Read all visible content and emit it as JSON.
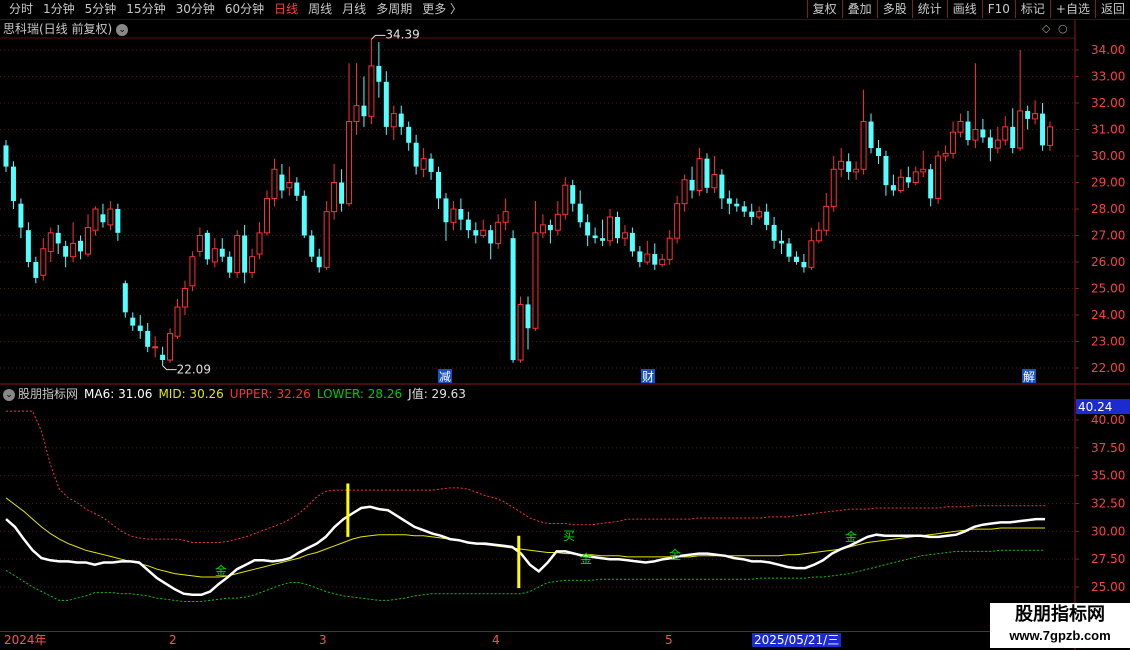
{
  "toolbar": {
    "periods": [
      "分时",
      "1分钟",
      "5分钟",
      "15分钟",
      "30分钟",
      "60分钟",
      "日线",
      "周线",
      "月线",
      "多周期",
      "更多"
    ],
    "active_period": "日线",
    "more_arrow": "〉",
    "buttons": [
      "复权",
      "叠加",
      "多股",
      "统计",
      "画线",
      "F10",
      "标记",
      "+自选",
      "返回"
    ]
  },
  "main": {
    "title": "思科瑞(日线 前复权)",
    "price_axis": [
      "34.00",
      "33.00",
      "32.00",
      "31.00",
      "30.00",
      "29.00",
      "28.00",
      "27.00",
      "26.00",
      "25.00",
      "24.00",
      "23.00",
      "22.00"
    ],
    "high_label": "34.39",
    "low_label": "22.09",
    "markers": [
      "减",
      "财",
      "解"
    ]
  },
  "indicator": {
    "name": "股朋指标网",
    "ma6_label": "MA6: 31.06",
    "mid_label": "MID: 30.26",
    "upper_label": "UPPER: 32.26",
    "lower_label": "LOWER: 28.26",
    "j_label": "J值: 29.63",
    "axis": [
      "40.00",
      "37.50",
      "35.00",
      "32.50",
      "30.00",
      "27.50",
      "25.00"
    ],
    "axis_top_value": "40.24",
    "signals": [
      "金",
      "买",
      "金",
      "金",
      "金"
    ]
  },
  "date_axis": {
    "labels": [
      "2024年",
      "2",
      "3",
      "4",
      "5"
    ],
    "highlight": "2025/05/21/三"
  },
  "watermark": {
    "line1": "股朋指标网",
    "line2": "www.7gpzb.com"
  },
  "colors": {
    "up": "#ff3030",
    "down": "#54ffff",
    "ma6": "#ffffff",
    "mid": "#e6e600",
    "upper": "#ff3030",
    "lower": "#00cc00"
  },
  "chart_data": {
    "type": "candlestick",
    "y_range": [
      22.0,
      34.0
    ],
    "candles": [
      [
        30.4,
        29.6,
        30.6,
        29.4
      ],
      [
        29.6,
        28.3,
        29.8,
        28.0
      ],
      [
        28.2,
        27.3,
        28.4,
        26.9
      ],
      [
        27.2,
        26.0,
        27.5,
        25.8
      ],
      [
        26.0,
        25.4,
        26.2,
        25.2
      ],
      [
        25.5,
        26.5,
        26.9,
        25.3
      ],
      [
        26.4,
        27.1,
        27.3,
        26.0
      ],
      [
        27.1,
        26.7,
        27.4,
        26.3
      ],
      [
        26.6,
        26.2,
        26.8,
        25.8
      ],
      [
        26.2,
        26.7,
        27.5,
        26.0
      ],
      [
        26.8,
        26.4,
        27.0,
        26.1
      ],
      [
        26.3,
        27.3,
        27.8,
        26.2
      ],
      [
        27.2,
        28.0,
        28.1,
        27.0
      ],
      [
        27.8,
        27.5,
        28.2,
        27.3
      ],
      [
        27.4,
        28.0,
        28.3,
        27.2
      ],
      [
        28.0,
        27.1,
        28.2,
        26.8
      ],
      [
        25.2,
        24.1,
        25.3,
        23.9
      ],
      [
        23.9,
        23.6,
        24.1,
        23.4
      ],
      [
        23.6,
        23.4,
        24.0,
        23.1
      ],
      [
        23.4,
        22.8,
        23.7,
        22.6
      ],
      [
        22.8,
        22.8,
        23.2,
        22.4
      ],
      [
        22.5,
        22.3,
        22.8,
        22.09
      ],
      [
        22.3,
        23.3,
        23.5,
        22.2
      ],
      [
        23.2,
        24.3,
        24.6,
        23.1
      ],
      [
        24.3,
        25.0,
        25.3,
        24.0
      ],
      [
        25.1,
        26.2,
        26.4,
        24.9
      ],
      [
        26.4,
        27.0,
        27.3,
        26.2
      ],
      [
        27.1,
        26.1,
        27.2,
        25.9
      ],
      [
        26.0,
        26.5,
        26.9,
        25.8
      ],
      [
        26.5,
        26.2,
        26.9,
        26.0
      ],
      [
        26.2,
        25.6,
        26.4,
        25.4
      ],
      [
        25.6,
        27.0,
        27.2,
        25.4
      ],
      [
        27.0,
        25.6,
        27.4,
        25.2
      ],
      [
        25.6,
        26.2,
        26.5,
        25.4
      ],
      [
        26.3,
        27.1,
        27.5,
        26.1
      ],
      [
        27.1,
        28.4,
        28.7,
        27.0
      ],
      [
        28.4,
        29.5,
        29.9,
        28.1
      ],
      [
        29.3,
        28.7,
        29.7,
        28.4
      ],
      [
        28.8,
        29.0,
        29.6,
        28.5
      ],
      [
        29.0,
        28.5,
        29.2,
        28.3
      ],
      [
        28.5,
        27.0,
        28.7,
        26.9
      ],
      [
        27.0,
        26.2,
        27.2,
        26.0
      ],
      [
        26.2,
        25.8,
        26.5,
        25.6
      ],
      [
        25.8,
        27.9,
        28.3,
        25.7
      ],
      [
        27.9,
        29.0,
        29.7,
        27.6
      ],
      [
        29.0,
        28.2,
        29.5,
        27.9
      ],
      [
        28.2,
        31.3,
        33.5,
        28.1
      ],
      [
        31.3,
        31.9,
        33.5,
        30.8
      ],
      [
        31.9,
        31.5,
        33.0,
        31.1
      ],
      [
        31.5,
        33.4,
        34.4,
        31.2
      ],
      [
        33.4,
        32.8,
        34.3,
        32.2
      ],
      [
        32.8,
        31.1,
        33.2,
        30.8
      ],
      [
        31.1,
        31.6,
        31.9,
        30.6
      ],
      [
        31.6,
        31.1,
        31.9,
        30.8
      ],
      [
        31.1,
        30.5,
        31.3,
        30.2
      ],
      [
        30.5,
        29.6,
        30.8,
        29.3
      ],
      [
        29.5,
        29.9,
        30.3,
        29.2
      ],
      [
        29.9,
        29.4,
        30.1,
        29.1
      ],
      [
        29.4,
        28.4,
        29.6,
        28.0
      ],
      [
        28.4,
        27.5,
        28.6,
        26.8
      ],
      [
        27.5,
        28.0,
        28.3,
        27.2
      ],
      [
        28.0,
        27.6,
        28.4,
        27.2
      ],
      [
        27.6,
        27.2,
        27.9,
        26.9
      ],
      [
        27.2,
        27.0,
        27.5,
        26.7
      ],
      [
        27.0,
        27.2,
        27.6,
        26.9
      ],
      [
        27.2,
        26.7,
        27.4,
        26.1
      ],
      [
        26.7,
        27.5,
        27.8,
        26.5
      ],
      [
        27.5,
        27.9,
        28.4,
        27.2
      ],
      [
        26.9,
        22.3,
        27.2,
        22.2
      ],
      [
        22.3,
        24.4,
        24.7,
        22.2
      ],
      [
        24.4,
        23.5,
        24.7,
        22.7
      ],
      [
        23.5,
        27.1,
        28.3,
        23.4
      ],
      [
        27.1,
        27.4,
        27.8,
        26.9
      ],
      [
        27.4,
        27.2,
        27.6,
        26.7
      ],
      [
        27.2,
        27.8,
        28.3,
        27.0
      ],
      [
        27.8,
        28.9,
        29.2,
        27.6
      ],
      [
        28.9,
        28.2,
        29.1,
        27.9
      ],
      [
        28.2,
        27.5,
        28.7,
        27.3
      ],
      [
        27.5,
        27.0,
        27.8,
        26.6
      ],
      [
        27.0,
        26.9,
        27.3,
        26.7
      ],
      [
        26.9,
        26.8,
        27.6,
        26.6
      ],
      [
        26.8,
        27.7,
        28.0,
        26.6
      ],
      [
        27.7,
        26.9,
        27.9,
        26.7
      ],
      [
        26.9,
        27.1,
        27.4,
        26.6
      ],
      [
        27.1,
        26.4,
        27.3,
        26.2
      ],
      [
        26.4,
        26.0,
        26.6,
        25.8
      ],
      [
        26.0,
        26.3,
        26.8,
        25.9
      ],
      [
        26.3,
        25.9,
        26.7,
        25.7
      ],
      [
        25.9,
        26.1,
        26.3,
        25.8
      ],
      [
        26.1,
        26.9,
        27.2,
        25.9
      ],
      [
        26.9,
        28.2,
        28.5,
        26.7
      ],
      [
        28.2,
        29.1,
        29.3,
        27.9
      ],
      [
        29.1,
        28.7,
        29.6,
        28.4
      ],
      [
        28.7,
        29.9,
        30.3,
        28.5
      ],
      [
        29.9,
        28.8,
        30.1,
        28.6
      ],
      [
        28.8,
        29.3,
        30.0,
        28.6
      ],
      [
        29.3,
        28.4,
        29.5,
        28.0
      ],
      [
        28.4,
        28.2,
        28.7,
        27.8
      ],
      [
        28.2,
        28.1,
        28.4,
        27.9
      ],
      [
        28.1,
        27.9,
        28.3,
        27.7
      ],
      [
        27.9,
        27.7,
        28.2,
        27.4
      ],
      [
        27.7,
        27.9,
        28.1,
        27.6
      ],
      [
        27.9,
        27.4,
        28.2,
        27.2
      ],
      [
        27.4,
        26.8,
        27.7,
        26.5
      ],
      [
        26.8,
        26.7,
        27.2,
        26.3
      ],
      [
        26.7,
        26.2,
        26.9,
        26.0
      ],
      [
        26.2,
        26.0,
        26.4,
        25.9
      ],
      [
        26.0,
        25.8,
        26.3,
        25.6
      ],
      [
        25.8,
        26.8,
        27.3,
        25.7
      ],
      [
        26.8,
        27.2,
        27.5,
        26.7
      ],
      [
        27.2,
        28.1,
        28.6,
        27.0
      ],
      [
        28.1,
        29.5,
        30.0,
        27.9
      ],
      [
        29.5,
        29.8,
        30.3,
        29.2
      ],
      [
        29.8,
        29.4,
        30.1,
        29.1
      ],
      [
        29.4,
        29.5,
        29.8,
        29.1
      ],
      [
        29.5,
        31.3,
        32.5,
        29.3
      ],
      [
        31.3,
        30.3,
        31.6,
        30.1
      ],
      [
        30.3,
        30.0,
        30.6,
        29.7
      ],
      [
        30.0,
        28.9,
        30.2,
        28.5
      ],
      [
        28.9,
        28.7,
        29.3,
        28.5
      ],
      [
        28.7,
        29.2,
        29.5,
        28.6
      ],
      [
        29.2,
        29.0,
        29.6,
        28.8
      ],
      [
        29.0,
        29.4,
        29.6,
        28.9
      ],
      [
        29.4,
        29.5,
        30.2,
        29.2
      ],
      [
        29.5,
        28.4,
        29.7,
        28.1
      ],
      [
        28.4,
        30.0,
        30.2,
        28.2
      ],
      [
        30.0,
        30.1,
        30.4,
        29.8
      ],
      [
        30.1,
        30.9,
        31.3,
        29.9
      ],
      [
        30.9,
        31.3,
        31.6,
        30.7
      ],
      [
        31.3,
        30.6,
        31.7,
        30.4
      ],
      [
        30.6,
        31.0,
        33.5,
        30.3
      ],
      [
        31.0,
        30.7,
        31.4,
        30.5
      ],
      [
        30.7,
        30.3,
        31.0,
        29.8
      ],
      [
        30.3,
        30.6,
        31.1,
        30.1
      ],
      [
        30.6,
        31.1,
        31.5,
        30.4
      ],
      [
        31.1,
        30.3,
        31.8,
        30.1
      ],
      [
        30.3,
        31.7,
        34.0,
        30.2
      ],
      [
        31.7,
        31.4,
        31.9,
        31.0
      ],
      [
        31.4,
        31.6,
        32.1,
        31.2
      ],
      [
        31.6,
        30.4,
        32.0,
        30.2
      ],
      [
        30.4,
        31.1,
        31.3,
        30.2
      ]
    ],
    "indicator_series": {
      "y_range": [
        25.0,
        40.0
      ],
      "ma6": [
        31.1,
        30.4,
        29.3,
        28.3,
        27.6,
        27.4,
        27.3,
        27.3,
        27.2,
        27.2,
        27.0,
        27.2,
        27.2,
        27.3,
        27.3,
        27.2,
        26.5,
        25.8,
        25.3,
        24.8,
        24.4,
        24.3,
        24.3,
        24.6,
        25.3,
        25.9,
        26.6,
        27.0,
        27.4,
        27.4,
        27.3,
        27.4,
        27.6,
        28.1,
        28.5,
        28.9,
        29.5,
        30.4,
        31.1,
        31.6,
        32.1,
        32.2,
        32.0,
        31.9,
        31.4,
        30.9,
        30.4,
        30.1,
        29.8,
        29.6,
        29.3,
        29.2,
        29.0,
        28.9,
        28.9,
        28.8,
        28.7,
        28.6,
        28.0,
        27.0,
        26.4,
        27.2,
        28.2,
        28.2,
        28.0,
        27.8,
        27.7,
        27.6,
        27.5,
        27.5,
        27.4,
        27.3,
        27.2,
        27.3,
        27.5,
        27.6,
        27.8,
        27.9,
        28.0,
        28.0,
        27.9,
        27.8,
        27.6,
        27.5,
        27.3,
        27.3,
        27.2,
        27.0,
        26.8,
        26.7,
        26.7,
        27.0,
        27.4,
        28.0,
        28.4,
        28.7,
        29.1,
        29.5,
        29.7,
        29.6,
        29.6,
        29.6,
        29.6,
        29.6,
        29.5,
        29.5,
        29.6,
        29.7,
        30.0,
        30.4,
        30.6,
        30.7,
        30.8,
        30.8,
        30.9,
        31.0,
        31.1,
        31.1
      ],
      "mid": [
        33.0,
        32.4,
        31.8,
        31.1,
        30.4,
        29.8,
        29.3,
        28.9,
        28.6,
        28.3,
        28.1,
        27.9,
        27.7,
        27.5,
        27.3,
        27.1,
        26.9,
        26.6,
        26.4,
        26.2,
        26.1,
        26.0,
        25.9,
        25.9,
        25.9,
        26.0,
        26.2,
        26.4,
        26.6,
        26.8,
        27.0,
        27.2,
        27.4,
        27.6,
        27.9,
        28.1,
        28.4,
        28.7,
        29.0,
        29.3,
        29.5,
        29.6,
        29.7,
        29.7,
        29.7,
        29.7,
        29.6,
        29.6,
        29.5,
        29.4,
        29.3,
        29.2,
        29.0,
        28.9,
        28.8,
        28.7,
        28.6,
        28.5,
        28.4,
        28.3,
        28.2,
        28.1,
        28.1,
        28.0,
        28.0,
        27.9,
        27.9,
        27.8,
        27.8,
        27.8,
        27.7,
        27.7,
        27.7,
        27.7,
        27.7,
        27.7,
        27.7,
        27.7,
        27.8,
        27.8,
        27.8,
        27.8,
        27.8,
        27.8,
        27.8,
        27.8,
        27.8,
        27.8,
        27.9,
        27.9,
        28.0,
        28.1,
        28.2,
        28.3,
        28.4,
        28.6,
        28.8,
        29.0,
        29.1,
        29.2,
        29.3,
        29.4,
        29.5,
        29.6,
        29.7,
        29.8,
        29.9,
        30.0,
        30.1,
        30.2,
        30.2,
        30.2,
        30.3,
        30.3,
        30.3,
        30.3,
        30.3,
        30.3
      ],
      "upper": [
        40.8,
        40.8,
        40.8,
        40.8,
        39.0,
        36.0,
        33.8,
        33.0,
        32.6,
        32.0,
        31.6,
        31.2,
        30.6,
        30.0,
        29.6,
        29.4,
        29.3,
        29.3,
        29.3,
        29.3,
        29.2,
        29.0,
        29.0,
        29.0,
        29.0,
        29.1,
        29.3,
        29.5,
        29.8,
        30.1,
        30.4,
        30.7,
        31.1,
        31.6,
        32.3,
        33.1,
        33.6,
        33.7,
        33.7,
        33.7,
        33.7,
        33.7,
        33.7,
        33.7,
        33.7,
        33.7,
        33.7,
        33.7,
        33.7,
        33.8,
        33.9,
        33.9,
        33.8,
        33.5,
        33.2,
        33.0,
        32.7,
        32.2,
        31.7,
        31.2,
        30.9,
        30.7,
        30.7,
        30.7,
        30.6,
        30.6,
        30.6,
        30.7,
        30.8,
        30.9,
        31.1,
        31.1,
        31.1,
        31.1,
        31.1,
        31.1,
        31.1,
        31.1,
        31.2,
        31.2,
        31.2,
        31.2,
        31.2,
        31.2,
        31.2,
        31.2,
        31.3,
        31.3,
        31.3,
        31.4,
        31.5,
        31.6,
        31.7,
        31.8,
        31.9,
        32.0,
        32.0,
        32.0,
        32.1,
        32.1,
        32.1,
        32.1,
        32.1,
        32.1,
        32.1,
        32.1,
        32.2,
        32.2,
        32.2,
        32.3,
        32.3,
        32.3,
        32.3,
        32.3,
        32.3,
        32.3,
        32.3,
        32.3
      ],
      "lower": [
        26.5,
        26.0,
        25.5,
        25.0,
        24.6,
        24.2,
        23.8,
        23.8,
        24.0,
        24.2,
        24.5,
        24.5,
        24.5,
        24.4,
        24.4,
        24.3,
        24.2,
        24.0,
        23.9,
        23.8,
        23.7,
        23.7,
        23.7,
        23.8,
        23.9,
        24.0,
        24.0,
        24.1,
        24.3,
        24.6,
        24.9,
        25.2,
        25.4,
        25.4,
        25.2,
        24.9,
        24.6,
        24.4,
        24.2,
        24.1,
        24.0,
        23.9,
        23.8,
        23.8,
        23.9,
        24.0,
        24.2,
        24.3,
        24.4,
        24.4,
        24.4,
        24.4,
        24.4,
        24.4,
        24.4,
        24.4,
        24.4,
        24.4,
        24.4,
        24.6,
        25.0,
        25.4,
        25.5,
        25.6,
        25.6,
        25.6,
        25.6,
        25.7,
        25.7,
        25.7,
        25.7,
        25.7,
        25.7,
        25.7,
        25.7,
        25.7,
        25.7,
        25.7,
        25.7,
        25.7,
        25.7,
        25.7,
        25.7,
        25.7,
        25.7,
        25.8,
        25.8,
        25.8,
        25.8,
        25.8,
        25.8,
        25.9,
        25.9,
        26.0,
        26.1,
        26.2,
        26.4,
        26.6,
        26.8,
        27.0,
        27.2,
        27.4,
        27.6,
        27.8,
        27.9,
        28.0,
        28.1,
        28.2,
        28.2,
        28.2,
        28.2,
        28.2,
        28.3,
        28.3,
        28.3,
        28.3,
        28.3,
        28.3
      ],
      "bars": [
        {
          "index": 46,
          "from": 29.5,
          "to": 34.3
        },
        {
          "index": 69,
          "from": 24.9,
          "to": 29.6
        }
      ]
    }
  }
}
